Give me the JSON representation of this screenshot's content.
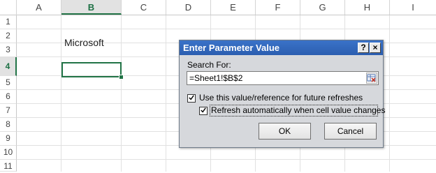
{
  "columns": [
    "A",
    "B",
    "C",
    "D",
    "E",
    "F",
    "G",
    "H",
    "I"
  ],
  "active_column": "B",
  "rows": [
    "1",
    "2",
    "3",
    "4",
    "5",
    "6",
    "7",
    "8",
    "9",
    "10",
    "11"
  ],
  "active_row": "4",
  "cells": {
    "B2": "Microsoft"
  },
  "dialog": {
    "title": "Enter Parameter Value",
    "help_button": "?",
    "close_button": "×",
    "search_label": "Search For:",
    "search_value": "=Sheet1!$B$2",
    "checkbox1": {
      "label": "Use this value/reference for future refreshes",
      "checked": true
    },
    "checkbox2": {
      "label": "Refresh automatically when cell value changes",
      "checked": true
    },
    "ok_label": "OK",
    "cancel_label": "Cancel"
  }
}
